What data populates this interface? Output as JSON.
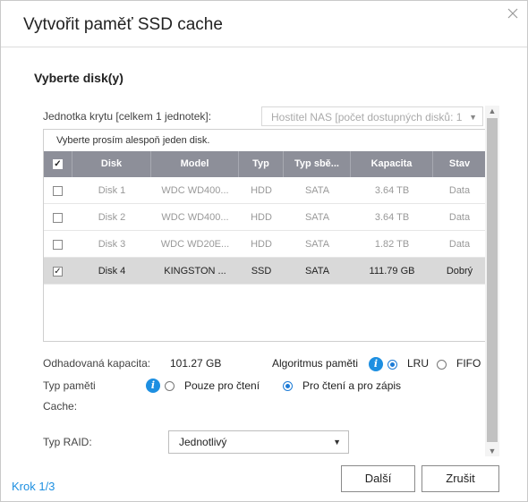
{
  "dialog": {
    "title": "Vytvořit paměť SSD cache",
    "section_title": "Vyberte disk(y)"
  },
  "enclosure": {
    "label": "Jednotka krytu [celkem 1 jednotek]:",
    "value": "Hostitel NAS [počet dostupných disků: 1"
  },
  "table": {
    "note": "Vyberte prosím alespoň jeden disk.",
    "columns": [
      "Disk",
      "Model",
      "Typ",
      "Typ sbě...",
      "Kapacita",
      "Stav"
    ],
    "rows": [
      {
        "checked": false,
        "disk": "Disk 1",
        "model": "WDC WD400...",
        "type": "HDD",
        "bus": "SATA",
        "capacity": "3.64 TB",
        "status": "Data"
      },
      {
        "checked": false,
        "disk": "Disk 2",
        "model": "WDC WD400...",
        "type": "HDD",
        "bus": "SATA",
        "capacity": "3.64 TB",
        "status": "Data"
      },
      {
        "checked": false,
        "disk": "Disk 3",
        "model": "WDC WD20E...",
        "type": "HDD",
        "bus": "SATA",
        "capacity": "1.82 TB",
        "status": "Data"
      },
      {
        "checked": true,
        "disk": "Disk 4",
        "model": "KINGSTON ...",
        "type": "SSD",
        "bus": "SATA",
        "capacity": "111.79 GB",
        "status": "Dobrý"
      }
    ]
  },
  "capacity": {
    "label": "Odhadovaná kapacita:",
    "value": "101.27 GB"
  },
  "algorithm": {
    "label": "Algoritmus paměti",
    "options": [
      "LRU",
      "FIFO"
    ],
    "selected": "LRU"
  },
  "cache_type": {
    "label_line1": "Typ paměti",
    "label_line2": "Cache:",
    "options": [
      "Pouze pro čtení",
      "Pro čtení a pro zápis"
    ],
    "selected": "Pro čtení a pro zápis"
  },
  "raid": {
    "label": "Typ RAID:",
    "value": "Jednotlivý"
  },
  "footer": {
    "step": "Krok 1/3",
    "next_label": "Další",
    "cancel_label": "Zrušit"
  },
  "icons": {
    "close": "close-icon",
    "info": "info-icon",
    "dropdown": "chevron-down-icon"
  },
  "colors": {
    "accent": "#1d8fe1",
    "table_header": "#8d8f99",
    "selected_row": "#d9d9d9"
  }
}
